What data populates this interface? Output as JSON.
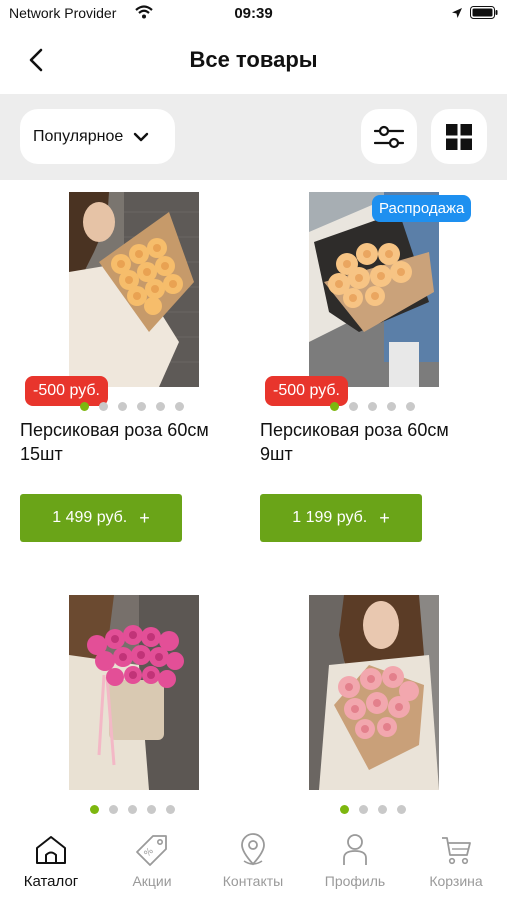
{
  "status_bar": {
    "carrier": "Network Provider",
    "time": "09:39"
  },
  "nav": {
    "title": "Все товары"
  },
  "toolbar": {
    "sort_label": "Популярное"
  },
  "products": [
    {
      "title_line1": "Персиковая роза 60см",
      "title_line2": "15шт",
      "discount": "-500 руб.",
      "price": "1 499 руб.",
      "plus": "+",
      "image_count": 6,
      "active_image": 0
    },
    {
      "title_line1": "Персиковая роза 60см",
      "title_line2": "9шт",
      "discount": "-500 руб.",
      "sale_badge": "Распродажа",
      "price": "1 199 руб.",
      "plus": "+",
      "image_count": 5,
      "active_image": 0
    },
    {
      "image_count": 5,
      "active_image": 0
    },
    {
      "image_count": 4,
      "active_image": 0
    }
  ],
  "tabs": [
    {
      "label": "Каталог",
      "icon": "home-icon",
      "active": true
    },
    {
      "label": "Акции",
      "icon": "tag-icon",
      "active": false
    },
    {
      "label": "Контакты",
      "icon": "map-pin-icon",
      "active": false
    },
    {
      "label": "Профиль",
      "icon": "user-icon",
      "active": false
    },
    {
      "label": "Корзина",
      "icon": "cart-icon",
      "active": false
    }
  ],
  "colors": {
    "accent_green": "#6aa418",
    "dot_active": "#7db70f",
    "discount_red": "#e8352c",
    "sale_blue": "#1e90f0",
    "toolbar_bg": "#ededed"
  }
}
